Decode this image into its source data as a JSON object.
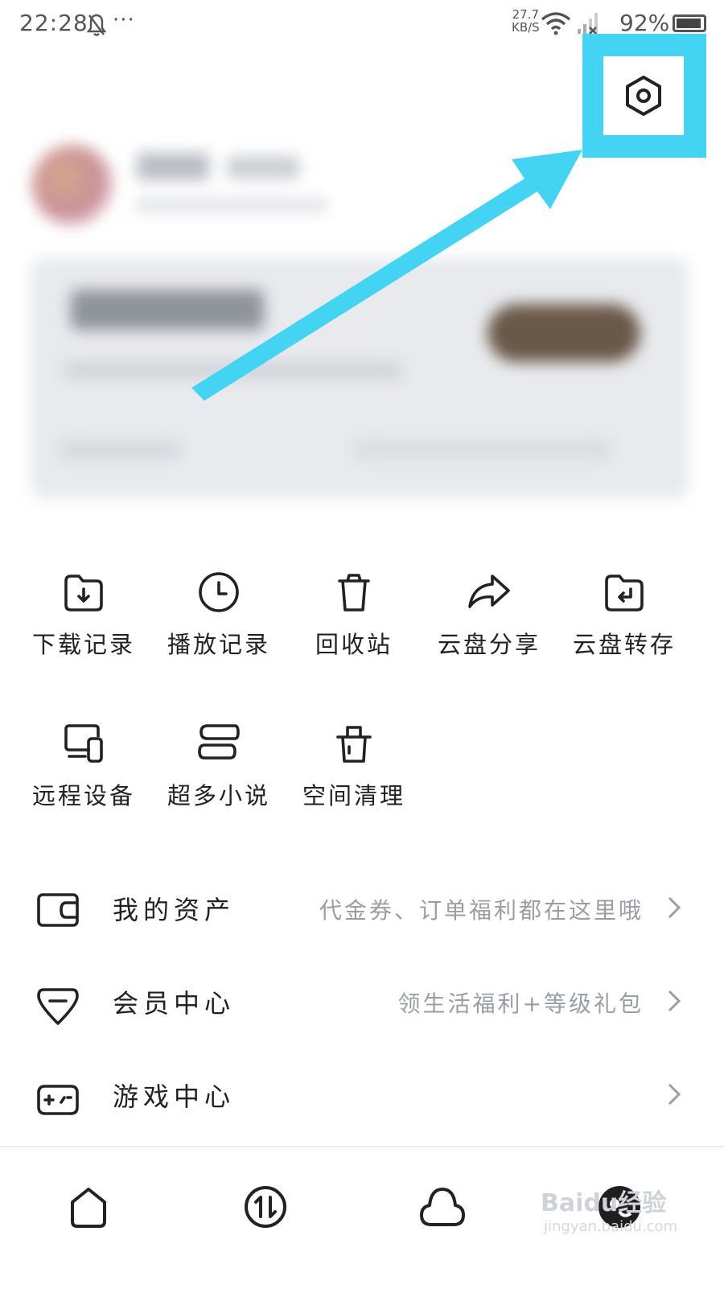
{
  "status_bar": {
    "time": "22:28",
    "notification_icon": "bell-off-icon",
    "more": "···",
    "net_speed_value": "27.7",
    "net_speed_unit": "KB/S",
    "battery_percent": "92%"
  },
  "header": {
    "settings_icon": "hexagon-settings-icon",
    "highlight_color": "#43d4f3"
  },
  "grid": {
    "items": [
      {
        "label": "下载记录",
        "icon": "folder-download-icon"
      },
      {
        "label": "播放记录",
        "icon": "clock-icon"
      },
      {
        "label": "回收站",
        "icon": "trash-icon"
      },
      {
        "label": "云盘分享",
        "icon": "share-arrow-icon"
      },
      {
        "label": "云盘转存",
        "icon": "folder-return-icon"
      },
      {
        "label": "远程设备",
        "icon": "devices-icon"
      },
      {
        "label": "超多小说",
        "icon": "book-icon"
      },
      {
        "label": "空间清理",
        "icon": "clean-bucket-icon"
      }
    ]
  },
  "list": {
    "rows": [
      {
        "title": "我的资产",
        "hint": "代金券、订单福利都在这里哦",
        "icon": "wallet-icon"
      },
      {
        "title": "会员中心",
        "hint": "领生活福利+等级礼包",
        "icon": "diamond-icon"
      },
      {
        "title": "游戏中心",
        "hint": "",
        "icon": "gamepad-icon"
      }
    ]
  },
  "tabbar": {
    "tabs": [
      "home-icon",
      "transfer-icon",
      "cloud-icon",
      "profile-avatar-icon"
    ]
  },
  "watermark": {
    "text": "Baidu经验",
    "sub": "jingyan.baidu.com"
  }
}
